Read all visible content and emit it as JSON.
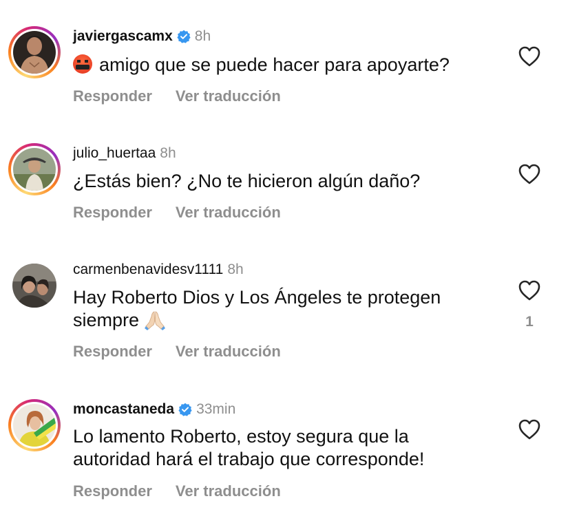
{
  "comments": [
    {
      "username": "javiergascamx",
      "verified": true,
      "time": "8h",
      "text": "amigo que se puede hacer para apoyarte?",
      "leading_emoji": "angry-face-symbols-icon",
      "reply_label": "Responder",
      "translate_label": "Ver traducción",
      "likes": ""
    },
    {
      "username": "julio_huertaa",
      "verified": false,
      "time": "8h",
      "text": "¿Estás bien? ¿No te hicieron algún daño?",
      "reply_label": "Responder",
      "translate_label": "Ver traducción",
      "likes": ""
    },
    {
      "username": "carmenbenavidesv1111",
      "verified": false,
      "time": "8h",
      "text_line1": "Hay Roberto Dios y Los Ángeles te protegen",
      "text_line2": "siempre",
      "trailing_emoji": "praying-hands-icon",
      "reply_label": "Responder",
      "translate_label": "Ver traducción",
      "likes": "1"
    },
    {
      "username": "moncastaneda",
      "verified": true,
      "time": "33min",
      "text_line1": "Lo lamento Roberto, estoy segura que la",
      "text_line2": "autoridad hará el trabajo que corresponde!",
      "reply_label": "Responder",
      "translate_label": "Ver traducción",
      "likes": ""
    }
  ],
  "colors": {
    "verified_badge": "#3897f0",
    "muted_text": "#8e8e8e"
  }
}
